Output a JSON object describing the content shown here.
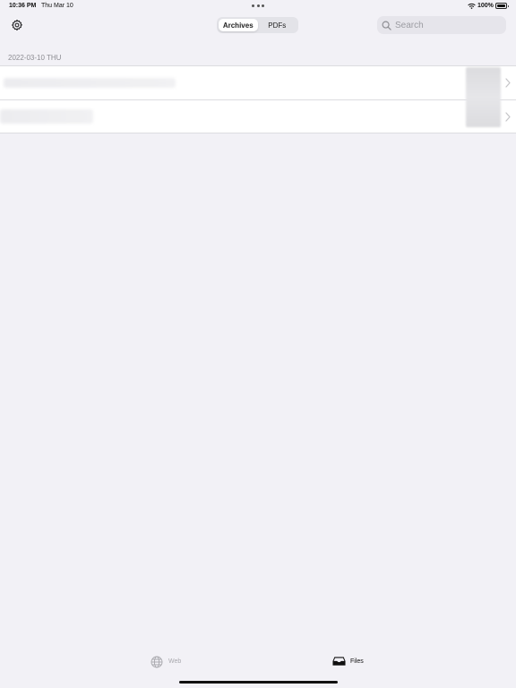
{
  "status_bar": {
    "time": "10:36 PM",
    "date": "Thu Mar 10",
    "battery_percent": "100%",
    "battery_level": 1.0
  },
  "nav": {
    "segments": [
      {
        "label": "Archives",
        "active": true
      },
      {
        "label": "PDFs",
        "active": false
      }
    ],
    "search_placeholder": "Search",
    "search_value": ""
  },
  "list": {
    "section_header": "2022-03-10 THU",
    "rows": [
      {
        "title": "",
        "blurred": true
      },
      {
        "title": "",
        "blurred": true
      }
    ]
  },
  "tab_bar": {
    "tabs": [
      {
        "label": "Web",
        "icon": "globe-icon",
        "active": false
      },
      {
        "label": "Files",
        "icon": "tray-icon",
        "active": true
      }
    ]
  },
  "colors": {
    "background": "#f2f1f6",
    "inactive_tab": "#a8a8ad",
    "active_tab": "#111111"
  }
}
